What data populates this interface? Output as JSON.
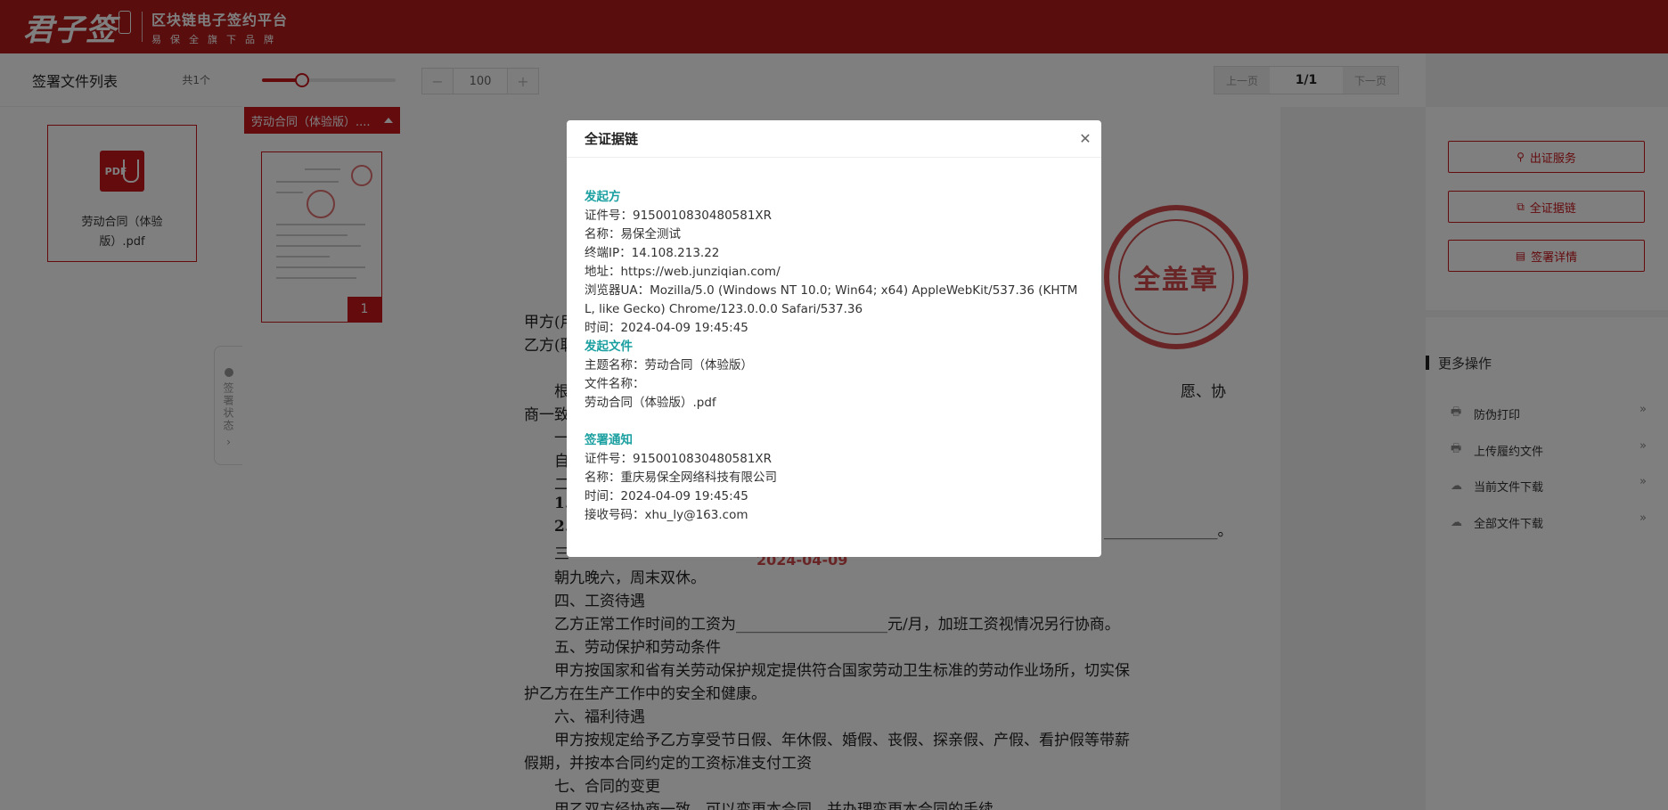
{
  "header": {
    "logo": "君子签",
    "platform_name": "区块链电子签约平台",
    "tagline": "易保全旗下品牌"
  },
  "file_list": {
    "title": "签署文件列表",
    "count": "共1个",
    "files": [
      {
        "name": "劳动合同（体验版）.pdf"
      }
    ]
  },
  "toolbar": {
    "zoom_level": 0.3,
    "zoom_minus": "−",
    "zoom_value": "100",
    "zoom_plus": "+",
    "prev_page": "上一页",
    "page_indicator": "1/1",
    "next_page": "下一页"
  },
  "doc_tab": {
    "label": "劳动合同（体验版）...."
  },
  "thumbnail": {
    "page_number": "1"
  },
  "sign_status": {
    "label": "签署状态"
  },
  "document": {
    "lines": [
      "甲方(用",
      "乙方(职",
      "根",
      "商一致",
      "一",
      "自",
      "二",
      "1.",
      "2.",
      "三",
      "朝九晚六，周末双休。",
      "四、工资待遇",
      "乙方正常工作时间的工资为____________________元/月，加班工资视情况另行协商。",
      "五、劳动保护和劳动条件",
      "甲方按国家和省有关劳动保护规定提供符合国家劳动卫生标准的劳动作业场所，切实保",
      "护乙方在生产工作中的安全和健康。",
      "六、福利待遇",
      "甲方按规定给予乙方享受节日假、年休假、婚假、丧假、探亲假、产假、看护假等带薪",
      "假期，并按本合同约定的工资标准支付工资",
      "七、合同的变更",
      "甲乙双方经协商一致，可以变更本合同，并办理变更本合同的手续"
    ],
    "right_fragments": [
      "愿、协",
      "_______________。"
    ],
    "stamp_text": "全盖章",
    "stamp_date": "2024-04-09"
  },
  "right_panel": {
    "buttons": [
      {
        "label": "出证服务"
      },
      {
        "label": "全证据链"
      },
      {
        "label": "签署详情"
      }
    ],
    "more_title": "更多操作",
    "operations": [
      {
        "label": "防伪打印"
      },
      {
        "label": "上传履约文件"
      },
      {
        "label": "当前文件下载"
      },
      {
        "label": "全部文件下载"
      }
    ]
  },
  "modal": {
    "title": "全证据链",
    "initiator": {
      "title": "发起方",
      "cert_no": "证件号：9150010830480581XR",
      "name": "名称：易保全测试",
      "ip": "终端IP：14.108.213.22",
      "address": "地址：https://web.junziqian.com/",
      "ua": "浏览器UA：Mozilla/5.0 (Windows NT 10.0; Win64; x64) AppleWebKit/537.36 (KHTML, like Gecko) Chrome/123.0.0.0 Safari/537.36",
      "time": "时间：2024-04-09 19:45:45"
    },
    "initiate_file": {
      "title": "发起文件",
      "subject": "主题名称：劳动合同（体验版）",
      "file_label": "文件名称：",
      "file_name": "劳动合同（体验版）.pdf"
    },
    "sign_notice": {
      "title": "签署通知",
      "cert_no": "证件号：9150010830480581XR",
      "name": "名称：重庆易保全网络科技有限公司",
      "time": "时间：2024-04-09 19:45:45",
      "receiver": "接收号码：xhu_ly@163.com"
    }
  },
  "colors": {
    "brand": "#b21a1a",
    "accent": "#c8161d",
    "section_title": "#1a9fa0"
  }
}
